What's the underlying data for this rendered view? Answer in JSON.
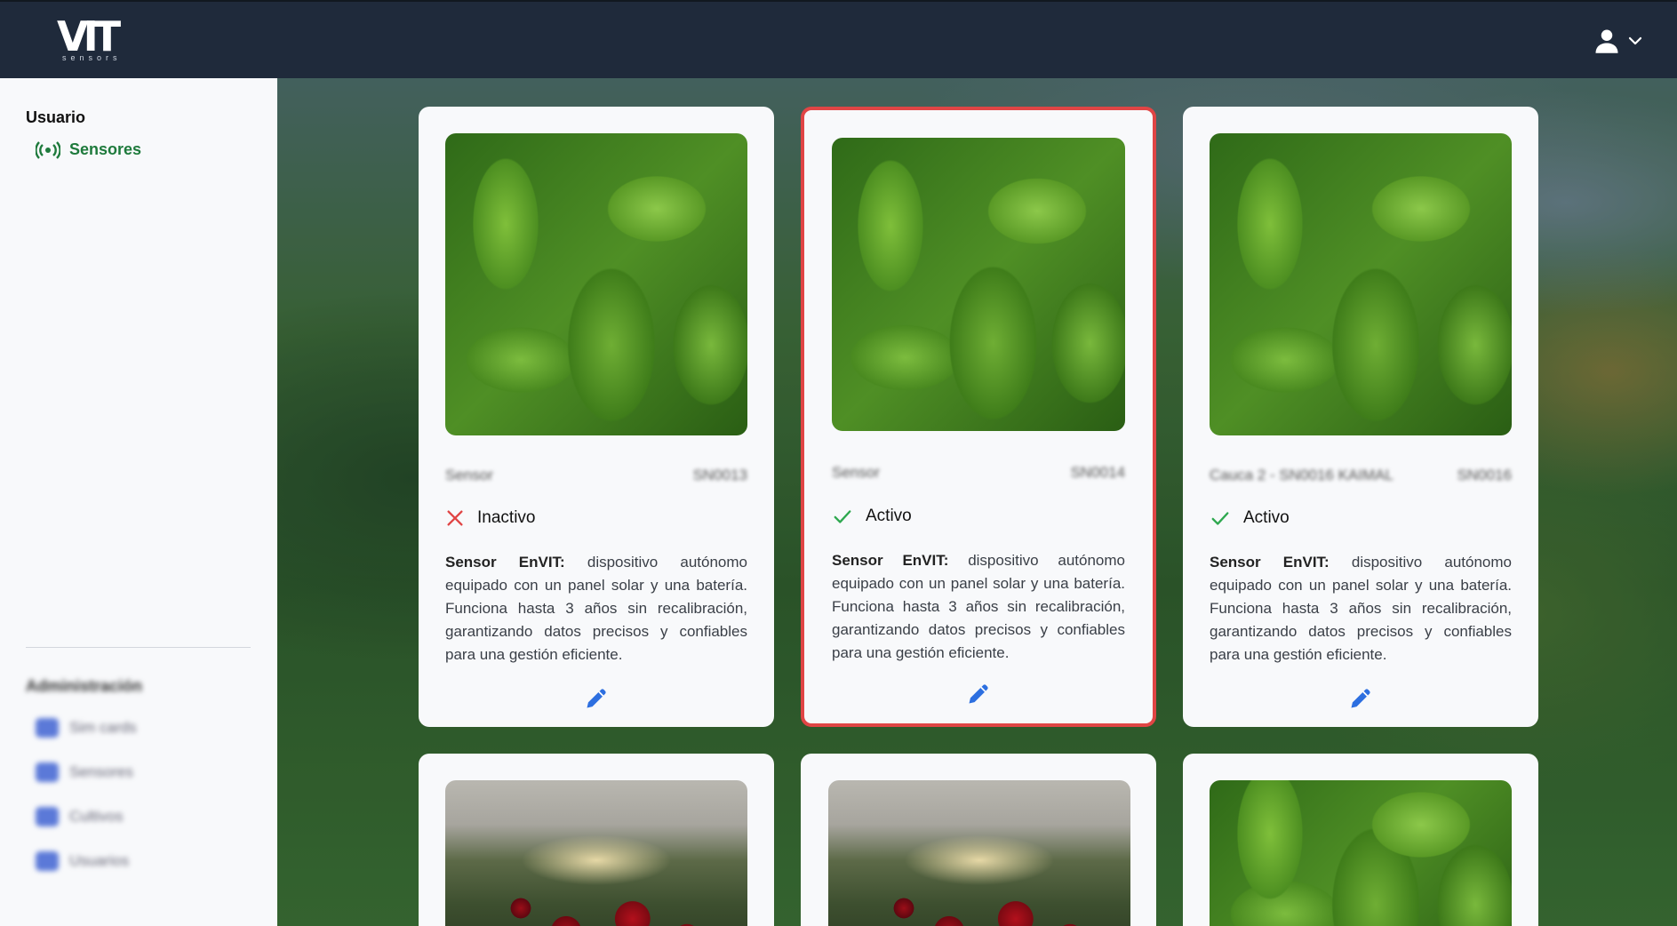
{
  "header": {
    "logo_text": "VIT",
    "logo_subtext": "sensors",
    "user_icon": "user-icon",
    "dropdown_icon": "chevron-down-icon"
  },
  "sidebar": {
    "section_title": "Usuario",
    "items": [
      {
        "label": "Sensores",
        "icon": "broadcast-icon",
        "color": "#1e7a3c"
      }
    ],
    "admin": {
      "title": "Administración",
      "items": [
        {
          "label": "Sim cards",
          "icon": "sim-card-icon"
        },
        {
          "label": "Sensores",
          "icon": "broadcast-icon"
        },
        {
          "label": "Cultivos",
          "icon": "leaf-icon"
        },
        {
          "label": "Usuarios",
          "icon": "user-icon"
        }
      ]
    }
  },
  "cards": [
    {
      "name": "Sensor",
      "serial": "SN0013",
      "status": "Inactivo",
      "status_icon": "x-icon",
      "status_color": "#e04545",
      "desc_bold": "Sensor EnVIT:",
      "desc_text": " dispositivo autónomo equipado con un panel solar y una batería. Funciona hasta 3 años sin recalibración, garantizando datos precisos y confiables para una gestión eficiente.",
      "image": "tea-leaves"
    },
    {
      "name": "Sensor",
      "serial": "SN0014",
      "status": "Activo",
      "status_icon": "check-icon",
      "status_color": "#2ea84f",
      "desc_bold": "Sensor EnVIT:",
      "desc_text": " dispositivo autónomo equipado con un panel solar y una batería. Funciona hasta 3 años sin recalibración, garantizando datos precisos y confiables para una gestión eficiente.",
      "image": "tea-leaves",
      "selected": true
    },
    {
      "name": "Cauca 2 - SN0016 KAIMAL",
      "serial": "SN0016",
      "status": "Activo",
      "status_icon": "check-icon",
      "status_color": "#2ea84f",
      "desc_bold": "Sensor EnVIT:",
      "desc_text": " dispositivo autónomo equipado con un panel solar y una batería. Funciona hasta 3 años sin recalibración, garantizando datos precisos y confiables para una gestión eficiente.",
      "image": "tea-leaves"
    }
  ],
  "bottom_cards": [
    {
      "image": "roses"
    },
    {
      "image": "roses"
    },
    {
      "image": "tea-leaves"
    }
  ],
  "colors": {
    "header_bg": "#1f2a3b",
    "accent_green": "#1e7a3c",
    "selected_border": "#e04545",
    "edit_icon": "#2d6fe0"
  }
}
